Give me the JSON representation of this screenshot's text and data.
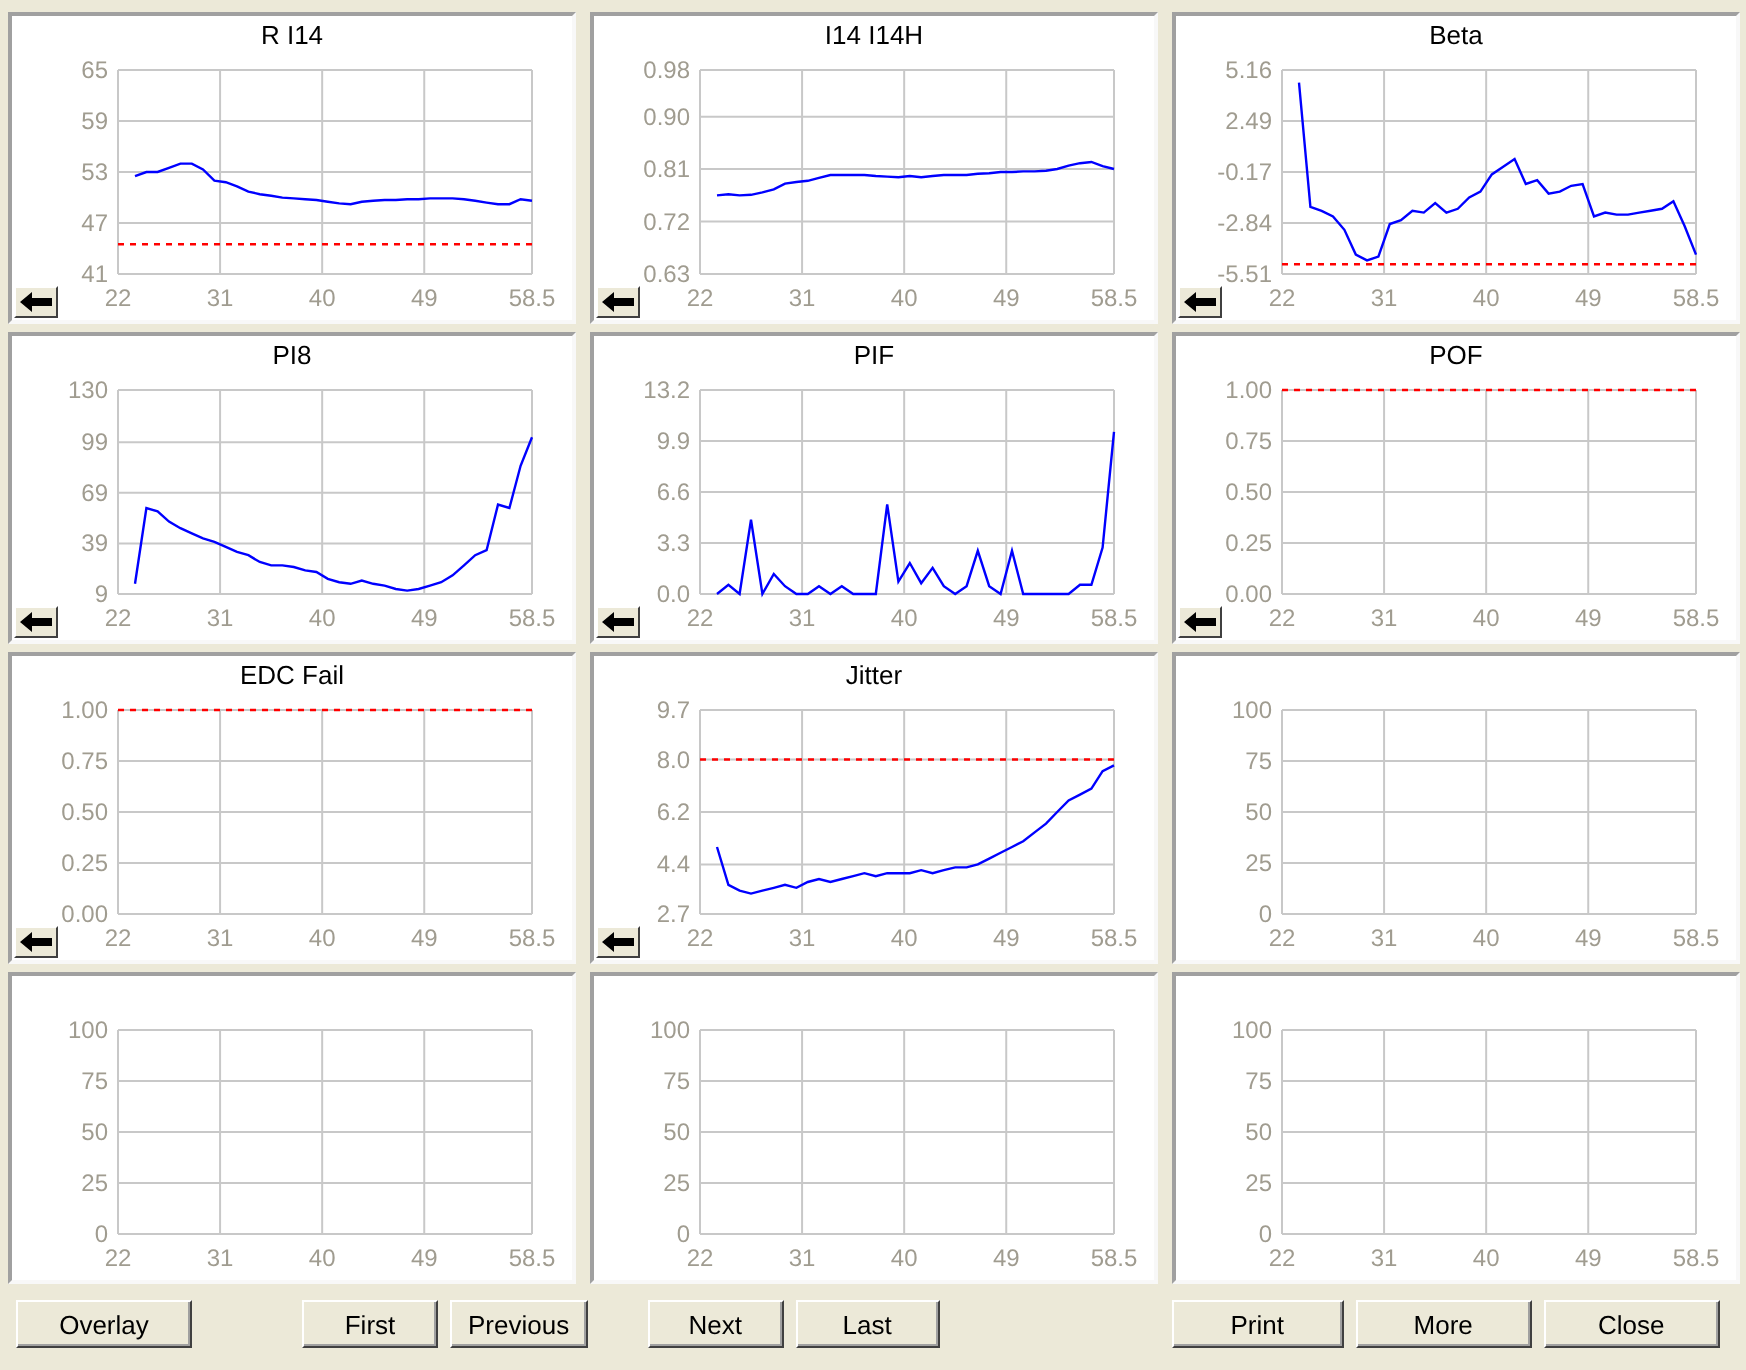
{
  "charts": [
    {
      "back_arrow": true,
      "chart_data": {
        "type": "line",
        "title": "R I14",
        "xlim": [
          22,
          58.5
        ],
        "xticks": [
          22,
          31,
          40,
          49,
          58.5
        ],
        "ylim": [
          41,
          65
        ],
        "yticks": [
          41,
          47,
          53,
          59,
          65
        ],
        "x": [
          23.5,
          24.5,
          25.5,
          26.5,
          27.5,
          28.5,
          29.5,
          30.5,
          31.5,
          32.5,
          33.5,
          34.5,
          35.5,
          36.5,
          37.5,
          38.5,
          39.5,
          40.5,
          41.5,
          42.5,
          43.5,
          44.5,
          45.5,
          46.5,
          47.5,
          48.5,
          49.5,
          50.5,
          51.5,
          52.5,
          53.5,
          54.5,
          55.5,
          56.5,
          57.5,
          58.5
        ],
        "grid": true,
        "series": [
          {
            "color": "#0000ff",
            "values": [
              52.5,
              53,
              53,
              53.5,
              54,
              54,
              53.3,
              52,
              51.8,
              51.3,
              50.7,
              50.4,
              50.2,
              50,
              49.9,
              49.8,
              49.7,
              49.5,
              49.3,
              49.2,
              49.5,
              49.6,
              49.7,
              49.7,
              49.8,
              49.8,
              49.9,
              49.9,
              49.9,
              49.8,
              49.6,
              49.4,
              49.2,
              49.2,
              49.8,
              49.6
            ]
          }
        ],
        "ref_lines": [
          {
            "axis": "y",
            "value": 44.5,
            "color": "#ff0000"
          }
        ]
      }
    },
    {
      "back_arrow": true,
      "chart_data": {
        "type": "line",
        "title": "I14 I14H",
        "xlim": [
          22,
          58.5
        ],
        "xticks": [
          22,
          31,
          40,
          49,
          58.5
        ],
        "ylim": [
          0.63,
          0.98
        ],
        "yticks": [
          {
            "value": 0.63,
            "label": "0.63"
          },
          {
            "value": 0.72,
            "label": "0.72"
          },
          {
            "value": 0.81,
            "label": "0.81"
          },
          {
            "value": 0.9,
            "label": "0.90"
          },
          {
            "value": 0.98,
            "label": "0.98"
          }
        ],
        "x": [
          23.5,
          24.5,
          25.5,
          26.5,
          27.5,
          28.5,
          29.5,
          30.5,
          31.5,
          32.5,
          33.5,
          34.5,
          35.5,
          36.5,
          37.5,
          38.5,
          39.5,
          40.5,
          41.5,
          42.5,
          43.5,
          44.5,
          45.5,
          46.5,
          47.5,
          48.5,
          49.5,
          50.5,
          51.5,
          52.5,
          53.5,
          54.5,
          55.5,
          56.5,
          57.5,
          58.5
        ],
        "grid": true,
        "series": [
          {
            "color": "#0000ff",
            "values": [
              0.765,
              0.767,
              0.765,
              0.766,
              0.77,
              0.775,
              0.785,
              0.788,
              0.79,
              0.795,
              0.8,
              0.8,
              0.8,
              0.8,
              0.798,
              0.797,
              0.796,
              0.798,
              0.796,
              0.798,
              0.8,
              0.8,
              0.8,
              0.802,
              0.803,
              0.805,
              0.805,
              0.806,
              0.806,
              0.807,
              0.81,
              0.816,
              0.82,
              0.822,
              0.815,
              0.81
            ]
          }
        ]
      }
    },
    {
      "back_arrow": true,
      "chart_data": {
        "type": "line",
        "title": "Beta",
        "xlim": [
          22,
          58.5
        ],
        "xticks": [
          22,
          31,
          40,
          49,
          58.5
        ],
        "ylim": [
          -5.51,
          5.16
        ],
        "yticks": [
          -5.51,
          -2.84,
          -0.17,
          2.49,
          5.16
        ],
        "x": [
          23.5,
          24.5,
          25.5,
          26.5,
          27.5,
          28.5,
          29.5,
          30.5,
          31.5,
          32.5,
          33.5,
          34.5,
          35.5,
          36.5,
          37.5,
          38.5,
          39.5,
          40.5,
          41.5,
          42.5,
          43.5,
          44.5,
          45.5,
          46.5,
          47.5,
          48.5,
          49.5,
          50.5,
          51.5,
          52.5,
          53.5,
          54.5,
          55.5,
          56.5,
          57.5,
          58.5
        ],
        "grid": true,
        "series": [
          {
            "color": "#0000ff",
            "values": [
              4.5,
              -2.0,
              -2.2,
              -2.5,
              -3.2,
              -4.5,
              -4.8,
              -4.6,
              -2.9,
              -2.7,
              -2.2,
              -2.3,
              -1.8,
              -2.3,
              -2.1,
              -1.5,
              -1.2,
              -0.3,
              0.1,
              0.5,
              -0.8,
              -0.6,
              -1.3,
              -1.2,
              -0.9,
              -0.8,
              -2.5,
              -2.3,
              -2.4,
              -2.4,
              -2.3,
              -2.2,
              -2.1,
              -1.7,
              -3.0,
              -4.5
            ]
          }
        ],
        "ref_lines": [
          {
            "axis": "y",
            "value": -5.0,
            "color": "#ff0000"
          }
        ]
      }
    },
    {
      "back_arrow": true,
      "chart_data": {
        "type": "line",
        "title": "PI8",
        "xlim": [
          22,
          58.5
        ],
        "xticks": [
          22,
          31,
          40,
          49,
          58.5
        ],
        "ylim": [
          9,
          130
        ],
        "yticks": [
          9,
          39,
          69,
          99,
          130
        ],
        "x": [
          23.5,
          24.5,
          25.5,
          26.5,
          27.5,
          28.5,
          29.5,
          30.5,
          31.5,
          32.5,
          33.5,
          34.5,
          35.5,
          36.5,
          37.5,
          38.5,
          39.5,
          40.5,
          41.5,
          42.5,
          43.5,
          44.5,
          45.5,
          46.5,
          47.5,
          48.5,
          49.5,
          50.5,
          51.5,
          52.5,
          53.5,
          54.5,
          55.5,
          56.5,
          57.5,
          58.5
        ],
        "grid": true,
        "series": [
          {
            "color": "#0000ff",
            "values": [
              15,
              60,
              58,
              52,
              48,
              45,
              42,
              40,
              37,
              34,
              32,
              28,
              26,
              26,
              25,
              23,
              22,
              18,
              16,
              15,
              17,
              15,
              14,
              12,
              11,
              12,
              14,
              16,
              20,
              26,
              32,
              35,
              62,
              60,
              85,
              102
            ]
          }
        ]
      }
    },
    {
      "back_arrow": true,
      "chart_data": {
        "type": "line",
        "title": "PIF",
        "xlim": [
          22,
          58.5
        ],
        "xticks": [
          22,
          31,
          40,
          49,
          58.5
        ],
        "ylim": [
          0,
          13.2
        ],
        "yticks": [
          {
            "value": 0,
            "label": "0.0"
          },
          {
            "value": 3.3,
            "label": "3.3"
          },
          {
            "value": 6.6,
            "label": "6.6"
          },
          {
            "value": 9.9,
            "label": "9.9"
          },
          {
            "value": 13.2,
            "label": "13.2"
          }
        ],
        "x": [
          23.5,
          24.5,
          25.5,
          26.5,
          27.5,
          28.5,
          29.5,
          30.5,
          31.5,
          32.5,
          33.5,
          34.5,
          35.5,
          36.5,
          37.5,
          38.5,
          39.5,
          40.5,
          41.5,
          42.5,
          43.5,
          44.5,
          45.5,
          46.5,
          47.5,
          48.5,
          49.5,
          50.5,
          51.5,
          52.5,
          53.5,
          54.5,
          55.5,
          56.5,
          57.5,
          58.5
        ],
        "grid": true,
        "series": [
          {
            "color": "#0000ff",
            "values": [
              0,
              0.6,
              0,
              4.8,
              0,
              1.3,
              0.5,
              0,
              0,
              0.5,
              0,
              0.5,
              0,
              0,
              0,
              5.8,
              0.8,
              2.0,
              0.7,
              1.7,
              0.5,
              0,
              0.5,
              2.8,
              0.5,
              0,
              2.8,
              0,
              0,
              0,
              0,
              0,
              0.6,
              0.6,
              3.0,
              10.5
            ]
          }
        ]
      }
    },
    {
      "back_arrow": true,
      "chart_data": {
        "type": "line",
        "title": "POF",
        "grid": true,
        "xlim": [
          22,
          58.5
        ],
        "xticks": [
          22,
          31,
          40,
          49,
          58.5
        ],
        "ylim": [
          0,
          1
        ],
        "yticks": [
          {
            "value": 0,
            "label": "0.00"
          },
          {
            "value": 0.25,
            "label": "0.25"
          },
          {
            "value": 0.5,
            "label": "0.50"
          },
          {
            "value": 0.75,
            "label": "0.75"
          },
          {
            "value": 1,
            "label": "1.00"
          }
        ],
        "ref_lines": [
          {
            "axis": "y",
            "value": 1,
            "color": "#ff0000"
          }
        ]
      }
    },
    {
      "back_arrow": true,
      "chart_data": {
        "type": "line",
        "title": "EDC Fail",
        "grid": true,
        "xlim": [
          22,
          58.5
        ],
        "xticks": [
          22,
          31,
          40,
          49,
          58.5
        ],
        "ylim": [
          0,
          1
        ],
        "yticks": [
          {
            "value": 0,
            "label": "0.00"
          },
          {
            "value": 0.25,
            "label": "0.25"
          },
          {
            "value": 0.5,
            "label": "0.50"
          },
          {
            "value": 0.75,
            "label": "0.75"
          },
          {
            "value": 1,
            "label": "1.00"
          }
        ],
        "ref_lines": [
          {
            "axis": "y",
            "value": 1,
            "color": "#ff0000"
          }
        ]
      }
    },
    {
      "back_arrow": true,
      "chart_data": {
        "type": "line",
        "title": "Jitter",
        "xlim": [
          22,
          58.5
        ],
        "xticks": [
          22,
          31,
          40,
          49,
          58.5
        ],
        "ylim": [
          2.7,
          9.7
        ],
        "yticks": [
          2.7,
          4.4,
          6.2,
          {
            "value": 8.0,
            "label": "8.0"
          },
          9.7
        ],
        "x": [
          23.5,
          24.5,
          25.5,
          26.5,
          27.5,
          28.5,
          29.5,
          30.5,
          31.5,
          32.5,
          33.5,
          34.5,
          35.5,
          36.5,
          37.5,
          38.5,
          39.5,
          40.5,
          41.5,
          42.5,
          43.5,
          44.5,
          45.5,
          46.5,
          47.5,
          48.5,
          49.5,
          50.5,
          51.5,
          52.5,
          53.5,
          54.5,
          55.5,
          56.5,
          57.5,
          58.5
        ],
        "grid": true,
        "series": [
          {
            "color": "#0000ff",
            "values": [
              5.0,
              3.7,
              3.5,
              3.4,
              3.5,
              3.6,
              3.7,
              3.6,
              3.8,
              3.9,
              3.8,
              3.9,
              4.0,
              4.1,
              4.0,
              4.1,
              4.1,
              4.1,
              4.2,
              4.1,
              4.2,
              4.3,
              4.3,
              4.4,
              4.6,
              4.8,
              5.0,
              5.2,
              5.5,
              5.8,
              6.2,
              6.6,
              6.8,
              7.0,
              7.6,
              7.8
            ]
          }
        ],
        "ref_lines": [
          {
            "axis": "y",
            "value": 8.0,
            "color": "#ff0000"
          }
        ]
      }
    },
    {
      "back_arrow": false,
      "chart_data": {
        "type": "line",
        "grid": true,
        "xlim": [
          22,
          58.5
        ],
        "xticks": [
          22,
          31,
          40,
          49,
          58.5
        ],
        "ylim": [
          0,
          100
        ],
        "yticks": [
          0,
          25,
          50,
          75,
          100
        ]
      }
    },
    {
      "back_arrow": false,
      "chart_data": {
        "type": "line",
        "grid": true,
        "xlim": [
          22,
          58.5
        ],
        "xticks": [
          22,
          31,
          40,
          49,
          58.5
        ],
        "ylim": [
          0,
          100
        ],
        "yticks": [
          0,
          25,
          50,
          75,
          100
        ]
      }
    },
    {
      "back_arrow": false,
      "chart_data": {
        "type": "line",
        "grid": true,
        "xlim": [
          22,
          58.5
        ],
        "xticks": [
          22,
          31,
          40,
          49,
          58.5
        ],
        "ylim": [
          0,
          100
        ],
        "yticks": [
          0,
          25,
          50,
          75,
          100
        ]
      }
    },
    {
      "back_arrow": false,
      "chart_data": {
        "type": "line",
        "grid": true,
        "xlim": [
          22,
          58.5
        ],
        "xticks": [
          22,
          31,
          40,
          49,
          58.5
        ],
        "ylim": [
          0,
          100
        ],
        "yticks": [
          0,
          25,
          50,
          75,
          100
        ]
      }
    }
  ],
  "button_groups": [
    [
      "Overlay"
    ],
    [
      "First",
      "Previous"
    ],
    [
      "Next",
      "Last"
    ],
    [
      "Print",
      "More",
      "Close"
    ]
  ]
}
